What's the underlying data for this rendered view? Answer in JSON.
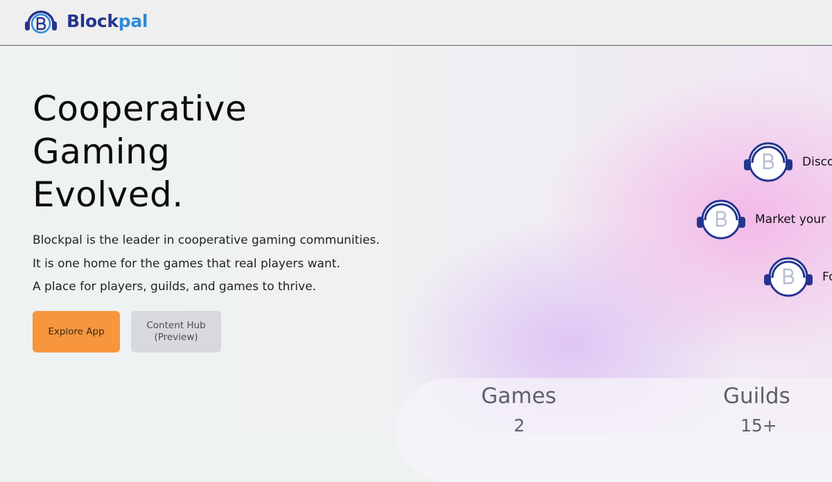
{
  "header": {
    "brand_part1": "Block",
    "brand_part2": "pal"
  },
  "hero": {
    "title_lines": [
      "Cooperative",
      "Gaming",
      "Evolved."
    ],
    "description": [
      "Blockpal is the leader in cooperative gaming communities.",
      "It is one home for the games that real players want.",
      "A place for players, guilds, and games to thrive."
    ]
  },
  "buttons": {
    "explore": "Explore App",
    "content_hub_line1": "Content Hub",
    "content_hub_line2": "(Preview)"
  },
  "features": [
    {
      "label": "Disco",
      "icon": "blockpal-headset-icon"
    },
    {
      "label": "Market your",
      "icon": "blockpal-headset-icon"
    },
    {
      "label": "Fo",
      "icon": "blockpal-headset-icon"
    }
  ],
  "stats": [
    {
      "label": "Games",
      "value": "2"
    },
    {
      "label": "Guilds",
      "value": "15+"
    }
  ],
  "colors": {
    "brand_dark": "#24358f",
    "brand_light": "#2f8ad8",
    "primary_button": "#f8963d",
    "secondary_button": "#d7d9dd"
  }
}
